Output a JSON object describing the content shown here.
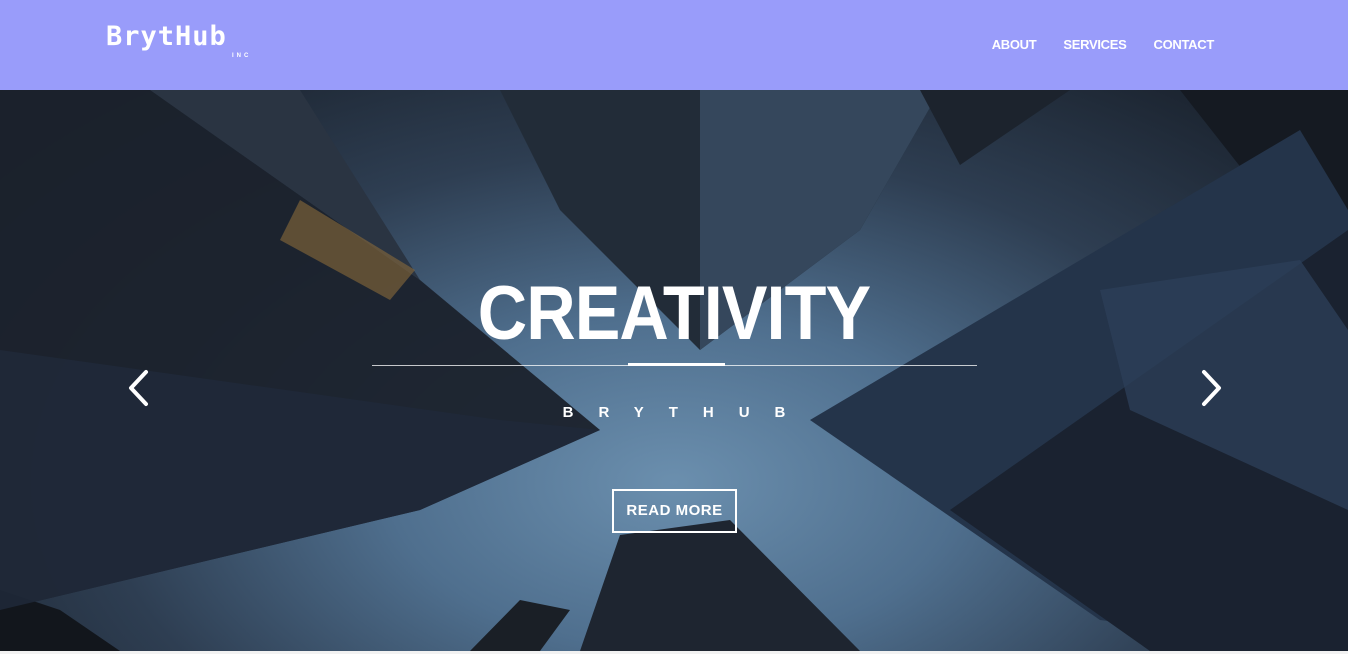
{
  "header": {
    "logo_main": "BrytHub",
    "logo_sub": "INC",
    "background": "#999cfa",
    "nav": [
      {
        "label": "ABOUT"
      },
      {
        "label": "SERVICES"
      },
      {
        "label": "CONTACT"
      }
    ]
  },
  "hero": {
    "title": "CREATIVITY",
    "subtitle": "BRYTHUB",
    "button_label": "READ MORE",
    "prev_icon": "chevron-left-icon",
    "next_icon": "chevron-right-icon"
  }
}
